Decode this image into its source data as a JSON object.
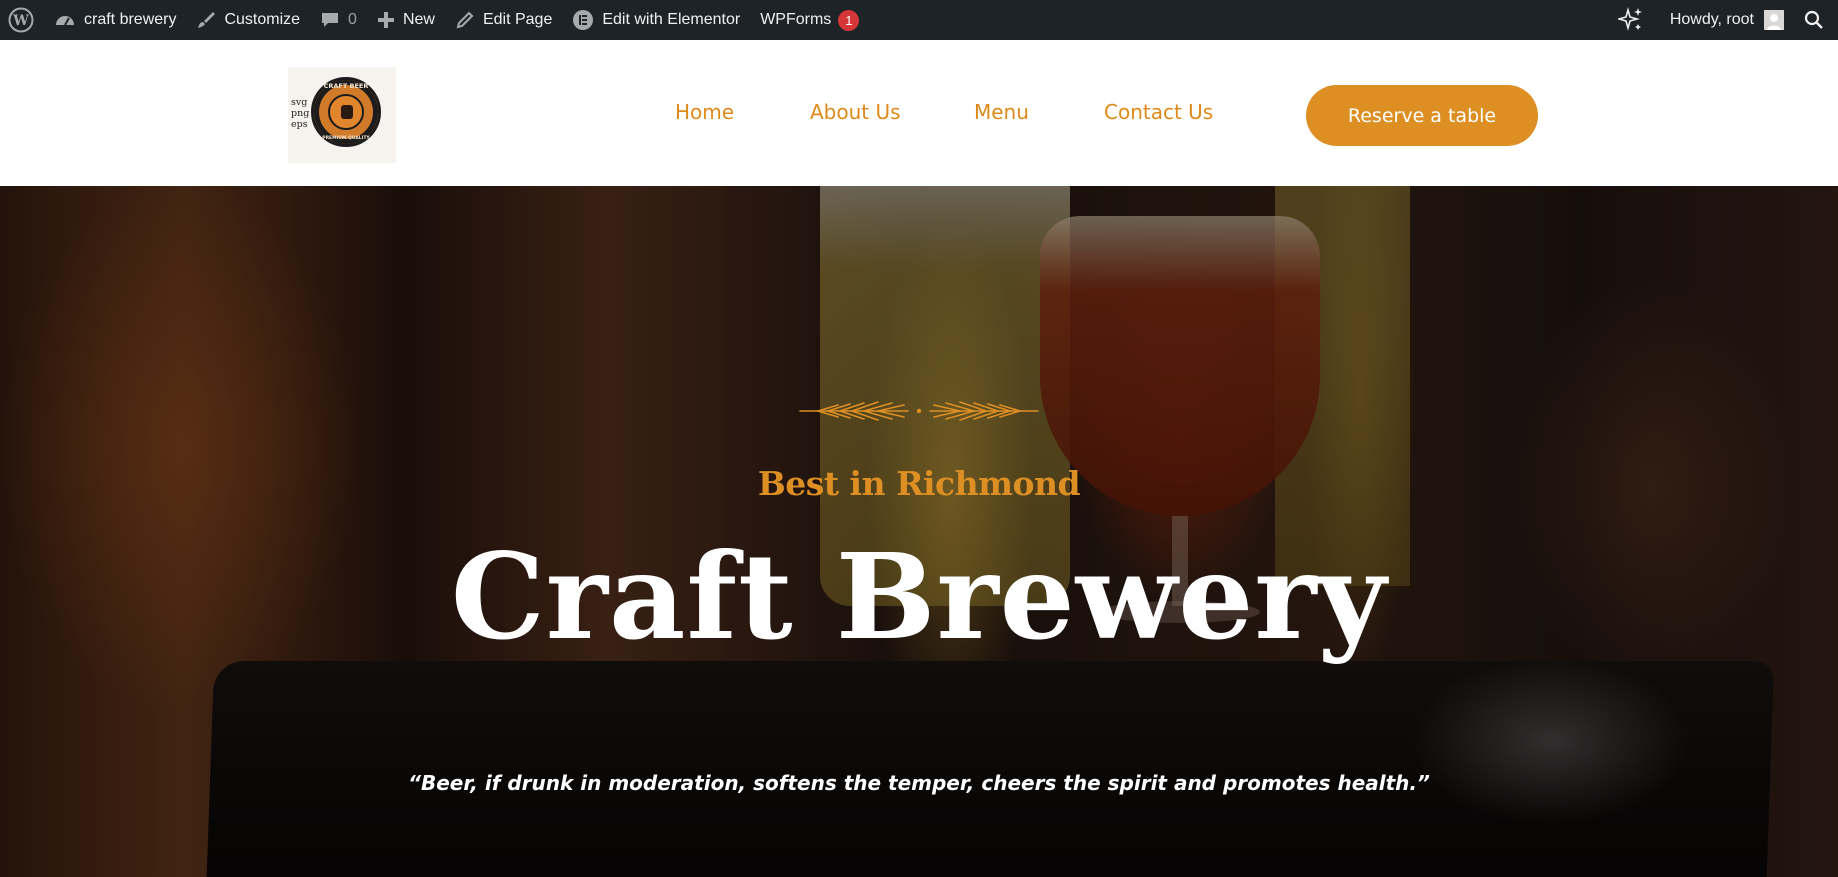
{
  "admin_bar": {
    "site_name": "craft brewery",
    "customize": "Customize",
    "comments_count": "0",
    "new_label": "New",
    "edit_page": "Edit Page",
    "edit_elementor": "Edit with Elementor",
    "wpforms": "WPForms",
    "wpforms_badge": "1",
    "greeting": "Howdy, root"
  },
  "header": {
    "logo": {
      "file_types": [
        "svg",
        "png",
        "eps"
      ],
      "badge_top": "CRAFT BEER",
      "badge_bottom": "PREMIUM QUALITY"
    },
    "nav": [
      "Home",
      "About Us",
      "Menu",
      "Contact Us"
    ],
    "cta": "Reserve a table"
  },
  "hero": {
    "tagline": "Best in Richmond",
    "title": "Craft Brewery",
    "quote": "“Beer, if drunk in moderation, softens the temper, cheers the spirit and promotes health.”"
  },
  "colors": {
    "accent": "#dd8f24",
    "nav_link": "#de8a1b",
    "admin_bar": "#1d2327",
    "badge": "#d63638"
  }
}
